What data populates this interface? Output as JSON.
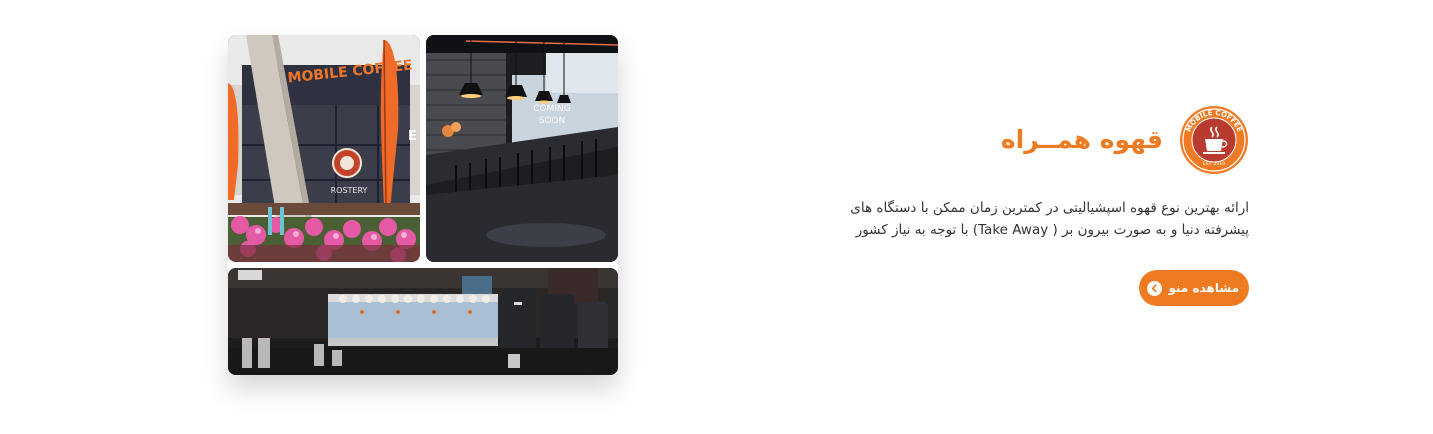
{
  "gallery": {
    "storefront": {
      "sign_text": "MOBILE COFFEE",
      "panel_text": "ROSTERY",
      "flag_letter": "E"
    },
    "interior": {
      "window_text_line1": "COMING",
      "window_text_line2": "SOON"
    }
  },
  "brand": {
    "title": "قهوه همــراه",
    "logo_ring_text": "MOBILE COFFEE",
    "logo_est_text": "EST. 2019"
  },
  "description": "ارائه بهترین نوع قهوه اسپشیالیتی در کمترین زمان ممکن با دستگاه های پیشرفته دنیا و به صورت بیرون بر ( Take Away) با توجه به نیاز کشور",
  "cta": {
    "label": "مشاهده منو"
  },
  "colors": {
    "accent": "#ee7b22",
    "text": "#333333",
    "background": "#ffffff"
  }
}
